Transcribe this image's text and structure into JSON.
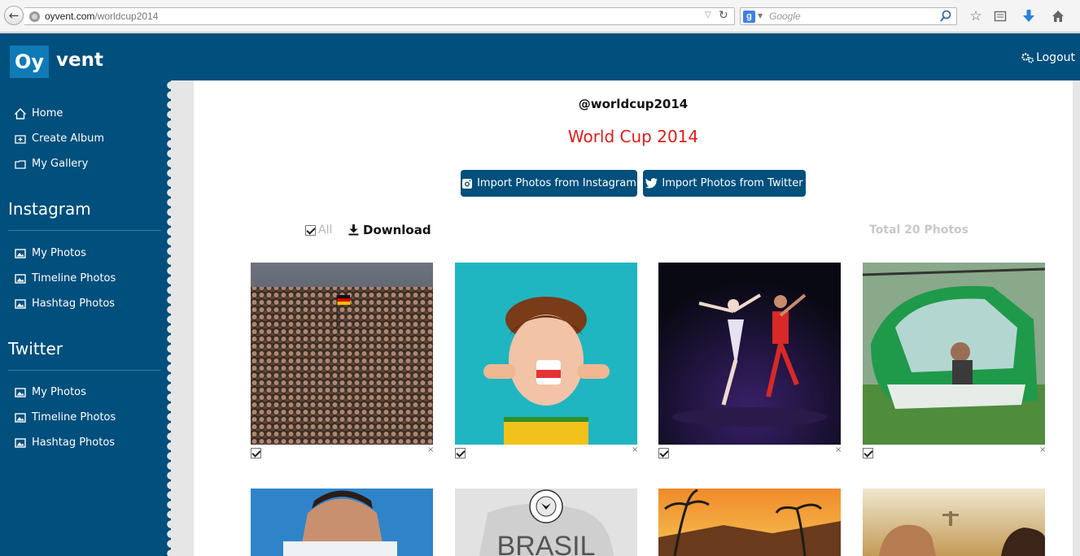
{
  "browser": {
    "url_host": "oyvent.com",
    "url_path": "/worldcup2014",
    "search_placeholder": "Google"
  },
  "header": {
    "logo_box": "Oy",
    "logo_rest": "vent",
    "logout_label": "Logout"
  },
  "sidebar": {
    "main_items": [
      {
        "label": "Home",
        "icon": "home-icon"
      },
      {
        "label": "Create Album",
        "icon": "create-album-icon"
      },
      {
        "label": "My Gallery",
        "icon": "folder-icon"
      }
    ],
    "instagram": {
      "heading": "Instagram",
      "items": [
        {
          "label": "My Photos",
          "icon": "image-icon"
        },
        {
          "label": "Timeline Photos",
          "icon": "image-icon"
        },
        {
          "label": "Hashtag Photos",
          "icon": "image-icon"
        }
      ]
    },
    "twitter": {
      "heading": "Twitter",
      "items": [
        {
          "label": "My Photos",
          "icon": "image-icon"
        },
        {
          "label": "Timeline Photos",
          "icon": "image-icon"
        },
        {
          "label": "Hashtag Photos",
          "icon": "image-icon"
        }
      ]
    }
  },
  "main": {
    "handle": "@worldcup2014",
    "album_title": "World Cup 2014",
    "import_instagram_label": "Import Photos from Instagram",
    "import_twitter_label": "Import Photos from Twitter",
    "all_label": "All",
    "download_label": "Download",
    "total_label": "Total 20 Photos",
    "photos": [
      {
        "subject": "fan-crowd-photo",
        "checked": true
      },
      {
        "subject": "child-face-paint-photo",
        "checked": true
      },
      {
        "subject": "ballet-footballer-photo",
        "checked": true
      },
      {
        "subject": "helicopter-photo",
        "checked": true
      },
      {
        "subject": "player-closeup-photo"
      },
      {
        "subject": "brasil-crest-photo",
        "text": "BRASIL"
      },
      {
        "subject": "rio-beach-photo"
      },
      {
        "subject": "players-christ-statue-photo"
      }
    ],
    "remove_glyph": "×"
  },
  "colors": {
    "brand_blue": "#014f7c",
    "logo_blue": "#0f7ab6",
    "title_red": "#e41b17"
  }
}
